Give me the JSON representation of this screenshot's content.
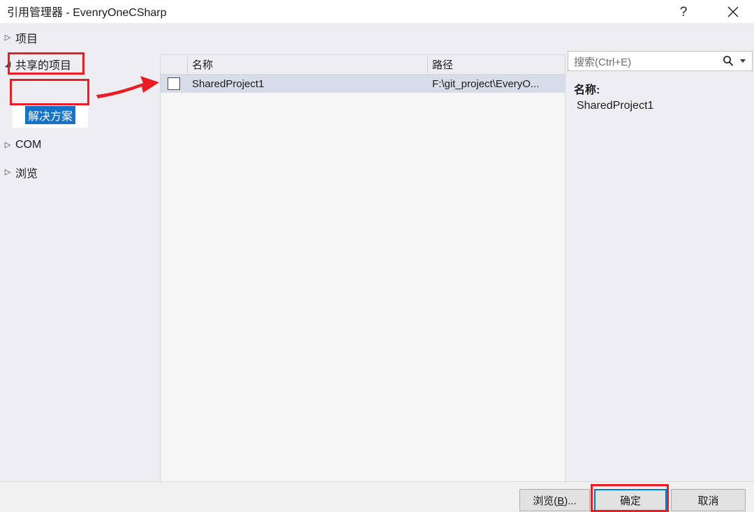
{
  "window": {
    "title": "引用管理器 - EvenryOneCSharp",
    "help_icon": "question-mark-icon",
    "close_icon": "close-icon"
  },
  "sidebar": {
    "items": [
      {
        "label": "项目",
        "arrow": "▷",
        "expanded": false
      },
      {
        "label": "共享的项目",
        "arrow": "◢",
        "expanded": true
      },
      {
        "label": "COM",
        "arrow": "▷",
        "expanded": false
      },
      {
        "label": "浏览",
        "arrow": "▷",
        "expanded": false
      }
    ],
    "selected_child": "解决方案"
  },
  "list": {
    "columns": [
      "名称",
      "路径"
    ],
    "rows": [
      {
        "checked": false,
        "name": "SharedProject1",
        "path": "F:\\git_project\\EveryO..."
      }
    ]
  },
  "search": {
    "placeholder": "搜索(Ctrl+E)",
    "value": "",
    "icon": "search-icon",
    "dropdown_icon": "chevron-down-icon"
  },
  "details": {
    "name_label": "名称:",
    "name_value": "SharedProject1"
  },
  "footer": {
    "browse_label": "浏览(B)...",
    "ok_label": "确定",
    "cancel_label": "取消"
  },
  "annotations": {
    "accent_color": "#ec1c24",
    "selection_color": "#1473c8",
    "focus_color": "#0078d7"
  }
}
